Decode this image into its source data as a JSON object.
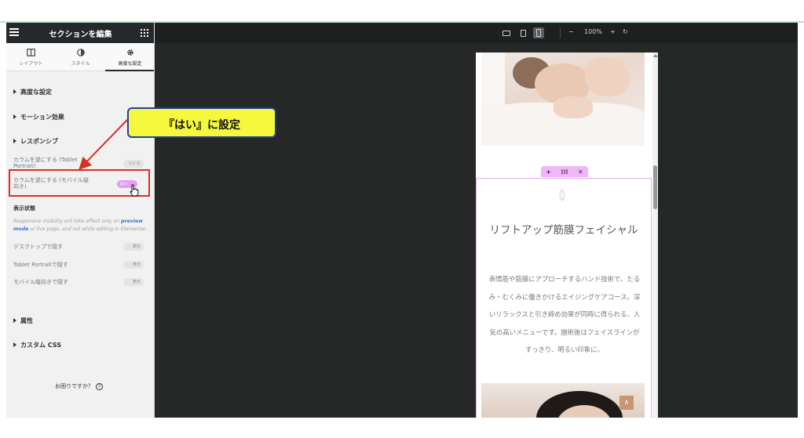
{
  "sidebar": {
    "title": "セクションを編集",
    "tabs": [
      {
        "label": "レイアウト",
        "icon": "columns-icon"
      },
      {
        "label": "スタイル",
        "icon": "contrast-icon"
      },
      {
        "label": "高度な設定",
        "icon": "gear-icon"
      }
    ],
    "sections": {
      "advanced": "高度な設定",
      "motion": "モーション効果",
      "responsive": "レスポンシブ",
      "attributes": "属性",
      "custom_css": "カスタム CSS"
    },
    "controls": {
      "reverse_tablet_label": "カラムを逆にする (Tablet Portrait)",
      "reverse_tablet_value": "いいえ",
      "reverse_mobile_label": "カラムを逆にする (モバイル縦向き)",
      "reverse_mobile_value": "はい"
    },
    "visibility": {
      "title": "表示状態",
      "note_pre": "Responsive visibility will take effect only on ",
      "note_link": "preview mode",
      "note_post": " or live page, and not while editing in Elementor.",
      "desktop_label": "デスクトップで隠す",
      "tablet_label": "Tablet Portraitで隠す",
      "mobile_label": "モバイル縦向きで隠す",
      "toggle_value": "表示"
    },
    "help": "お困りですか？",
    "help_icon": "?"
  },
  "callout": {
    "text": "『はい』に設定",
    "color": "#f6f83d",
    "border": "#1f3ea3",
    "arrow_color": "#d93025"
  },
  "toolbar": {
    "zoom": "100%",
    "minus": "−",
    "plus": "+",
    "reset": "↻"
  },
  "preview": {
    "section_handle": {
      "add": "+",
      "move": "⁝⁝⁝",
      "delete": "✕"
    },
    "service_title": "リフトアップ筋膜フェイシャル",
    "service_desc": "表情筋や筋膜にアプローチするハンド技術で、たるみ・むくみに働きかけるエイジングケアコース。深いリラックスと引き締め効果が同時に得られる、人気の高いメニューです。施術後はフェイスラインがすっきり、明るい印象に。",
    "back_to_top": "∧",
    "accent": "#c99673"
  }
}
